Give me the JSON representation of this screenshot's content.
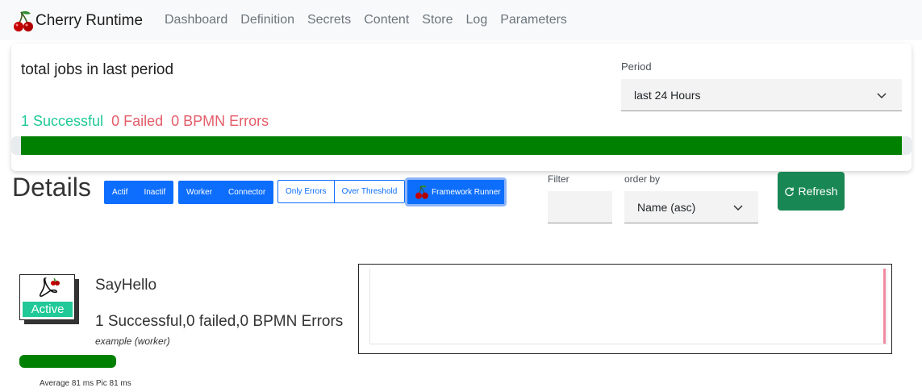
{
  "app": {
    "title": "Cherry Runtime",
    "nav": [
      "Dashboard",
      "Definition",
      "Secrets",
      "Content",
      "Store",
      "Log",
      "Parameters"
    ]
  },
  "stats": {
    "title": "total jobs in last period",
    "successful": "1 Successful",
    "failed": "0 Failed",
    "bpmn_errors": "0 BPMN Errors",
    "period_label": "Period",
    "period_value": "last 24 Hours",
    "success_fraction": 1.0
  },
  "details": {
    "title": "Details",
    "filters": {
      "group1": [
        "Actif",
        "Inactif"
      ],
      "group2": [
        "Worker",
        "Connector"
      ],
      "group3": [
        "Only Errors",
        "Over Threshold"
      ],
      "framework_runner": "Framework Runner"
    },
    "filter_label": "Filter",
    "filter_value": "",
    "order_label": "order by",
    "order_value": "Name (asc)",
    "refresh": "Refresh"
  },
  "jobs": [
    {
      "name": "SayHello",
      "status": "Active",
      "stats": "1 Successful,0 failed,0 BPMN Errors",
      "type": "example (worker)",
      "success_fraction": 1.0,
      "timing": "Average 81 ms Pic 81 ms"
    }
  ],
  "colors": {
    "primary": "#0d6efd",
    "success_bar": "#008000",
    "success_text": "#20c997",
    "danger_text": "#e35d6a",
    "refresh": "#198754"
  }
}
